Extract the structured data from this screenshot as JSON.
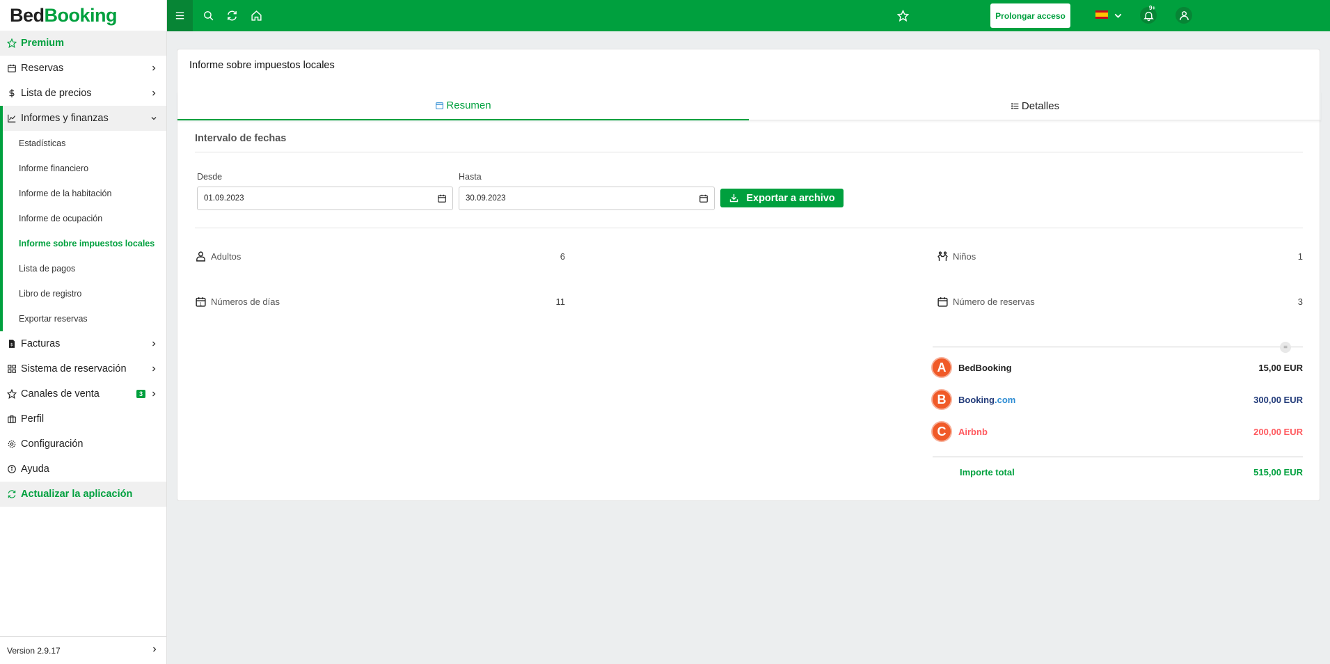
{
  "brand": {
    "part1": "Bed",
    "part2": "Booking"
  },
  "sidebar": {
    "premium": "Premium",
    "items": [
      {
        "label": "Reservas",
        "icon": "calendar-icon"
      },
      {
        "label": "Lista de precios",
        "icon": "dollar-icon"
      },
      {
        "label": "Informes y finanzas",
        "icon": "chart-icon"
      }
    ],
    "subitems": [
      {
        "label": "Estadísticas"
      },
      {
        "label": "Informe financiero"
      },
      {
        "label": "Informe de la habitación"
      },
      {
        "label": "Informe de ocupación"
      },
      {
        "label": "Informe sobre impuestos locales"
      },
      {
        "label": "Lista de pagos"
      },
      {
        "label": "Libro de registro"
      },
      {
        "label": "Exportar reservas"
      }
    ],
    "items2": [
      {
        "label": "Facturas",
        "icon": "invoice-icon"
      },
      {
        "label": "Sistema de reservación",
        "icon": "grid-icon"
      },
      {
        "label": "Canales de venta",
        "icon": "star-icon",
        "badge": "3"
      },
      {
        "label": "Perfil",
        "icon": "briefcase-icon"
      },
      {
        "label": "Configuración",
        "icon": "gear-icon"
      },
      {
        "label": "Ayuda",
        "icon": "info-icon"
      }
    ],
    "update": "Actualizar la aplicación",
    "version": "Version 2.9.17"
  },
  "topbar": {
    "prolong": "Prolongar acceso",
    "notif_count": "9+",
    "accent": "#00a03e"
  },
  "page": {
    "title": "Informe sobre impuestos locales",
    "tabs": [
      {
        "label": "Resumen"
      },
      {
        "label": "Detalles"
      }
    ],
    "section_title": "Intervalo de fechas",
    "from_label": "Desde",
    "from_value": "01.09.2023",
    "to_label": "Hasta",
    "to_value": "30.09.2023",
    "export_label": "Exportar a archivo"
  },
  "stats": {
    "adults": {
      "label": "Adultos",
      "value": "6"
    },
    "children": {
      "label": "Niños",
      "value": "1"
    },
    "days": {
      "label": "Números de días",
      "value": "11"
    },
    "reservations": {
      "label": "Número de reservas",
      "value": "3"
    }
  },
  "sources": [
    {
      "name": "BedBooking",
      "amount": "15,00 EUR",
      "logo": "A"
    },
    {
      "name": "Booking",
      "name_suffix": ".com",
      "amount": "300,00 EUR",
      "logo": "B"
    },
    {
      "name": "Airbnb",
      "amount": "200,00 EUR",
      "logo": "C"
    }
  ],
  "total": {
    "label": "Importe total",
    "amount": "515,00 EUR"
  }
}
